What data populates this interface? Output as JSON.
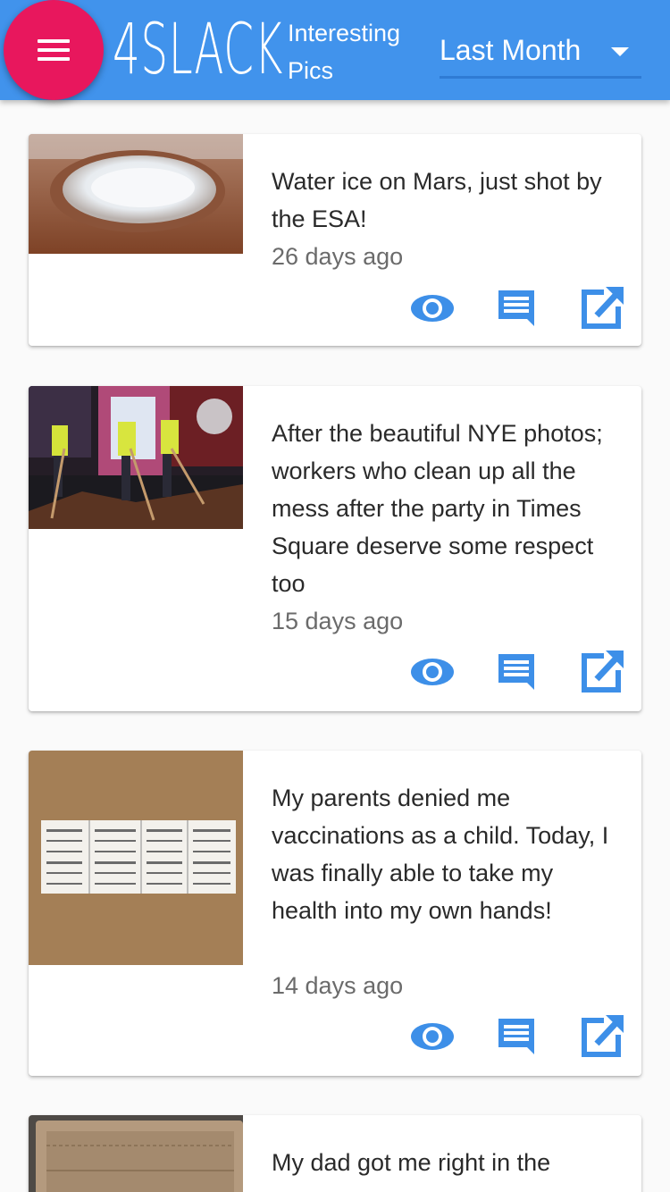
{
  "app": {
    "logo": "4SLACK",
    "subtitle": "Interesting Pics",
    "period": "Last Month"
  },
  "theme": {
    "header": "#4193ec",
    "menu_button": "#e8175d",
    "icon": "#3d8fe8"
  },
  "posts": [
    {
      "title": "Water ice on Mars, just shot by the ESA!",
      "time": "26 days ago",
      "image": "mars-crater-photo"
    },
    {
      "title": "After the beautiful NYE photos; workers who clean up all the mess after the party in Times Square deserve some respect too",
      "time": "15 days ago",
      "image": "times-square-cleanup-photo"
    },
    {
      "title": "My parents denied me vaccinations as a child. Today, I was finally able to take my health into my own hands!",
      "time": "14 days ago",
      "image": "vaccination-records-photo"
    },
    {
      "title": "My dad got me right in the",
      "time": "",
      "image": "wallet-photo"
    }
  ],
  "icons": {
    "view": "eye-icon",
    "comments": "comment-icon",
    "open": "open-external-icon"
  }
}
